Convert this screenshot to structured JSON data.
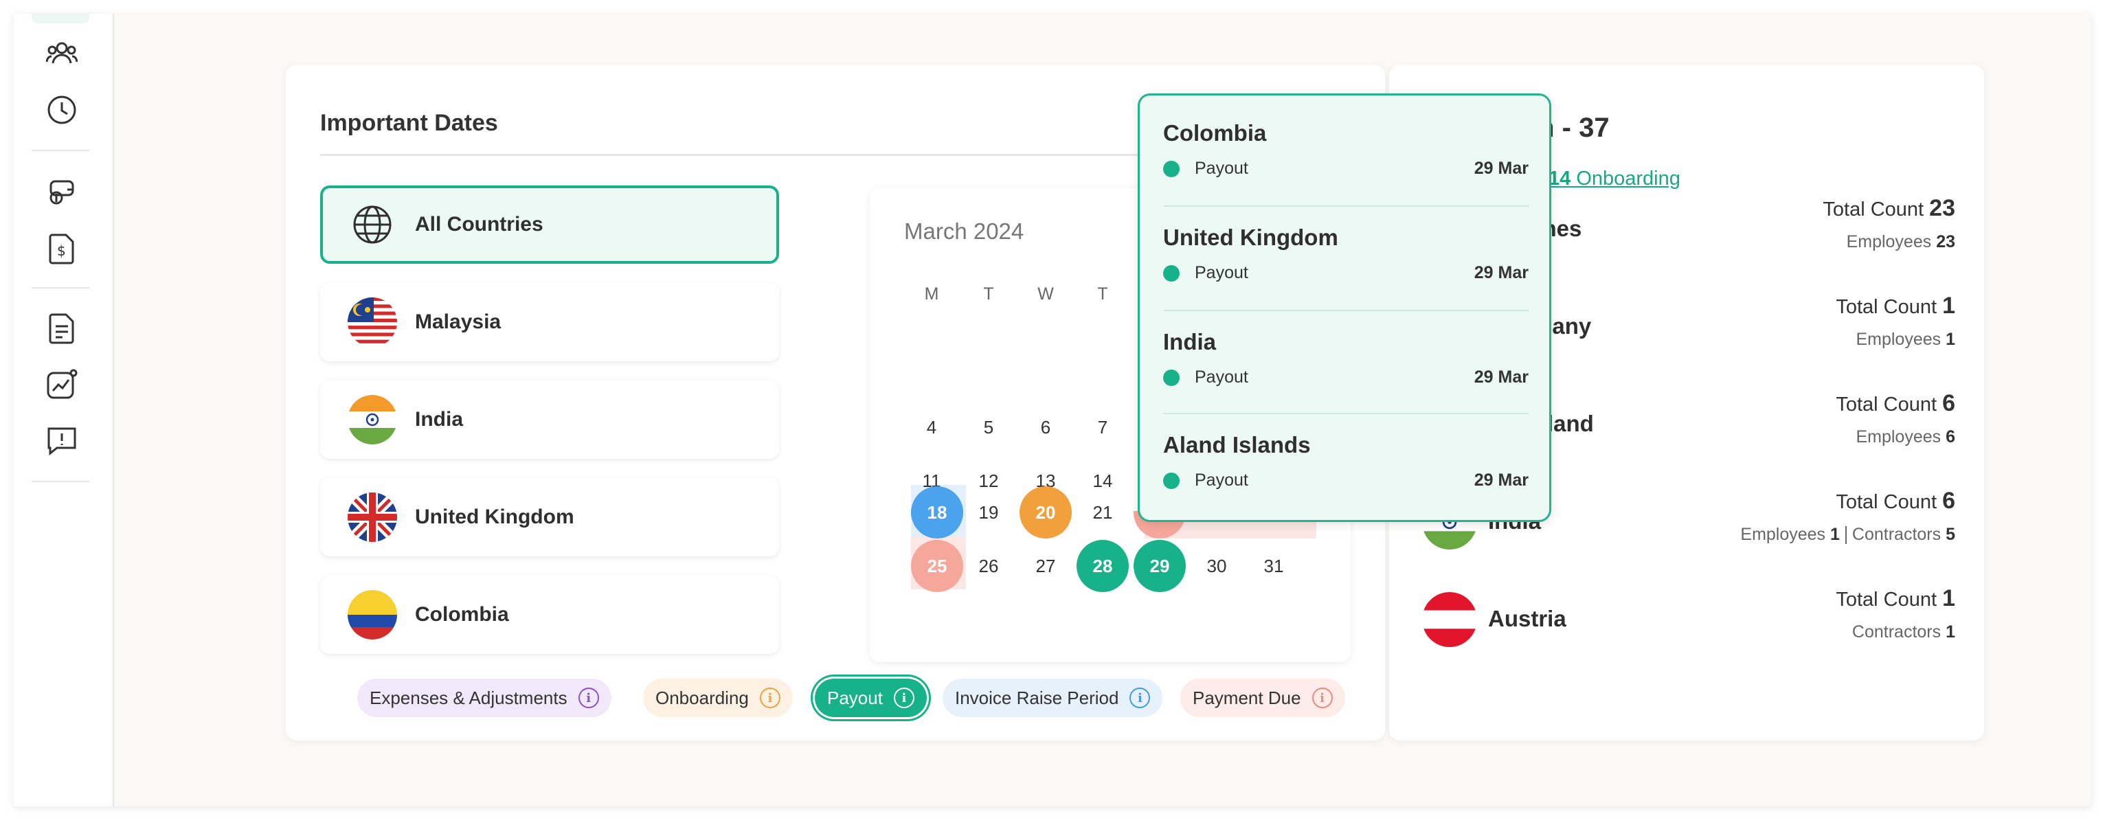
{
  "important_dates": {
    "title": "Important Dates",
    "countries": [
      {
        "name": "All Countries",
        "icon": "globe-icon",
        "active": true
      },
      {
        "name": "Malaysia",
        "icon": "malaysia-flag",
        "active": false
      },
      {
        "name": "India",
        "icon": "india-flag",
        "active": false
      },
      {
        "name": "United Kingdom",
        "icon": "uk-flag",
        "active": false
      },
      {
        "name": "Colombia",
        "icon": "colombia-flag",
        "active": false
      }
    ]
  },
  "calendar": {
    "month": "March 2024",
    "weekdays": [
      "M",
      "T",
      "W",
      "T"
    ],
    "days": {
      "d4": "4",
      "d5": "5",
      "d6": "6",
      "d7": "7",
      "d11": "11",
      "d12": "12",
      "d13": "13",
      "d14": "14",
      "d18": "18",
      "d19": "19",
      "d20": "20",
      "d21": "21",
      "d25": "25",
      "d26": "26",
      "d27": "27",
      "d28": "28",
      "d29": "29",
      "d30": "30",
      "d31": "31"
    }
  },
  "legend": [
    {
      "label": "Expenses & Adjustments",
      "color": "#8a4fd6",
      "bg": "#f1e9fb"
    },
    {
      "label": "Onboarding",
      "color": "#f0a23a",
      "bg": "#fdf1e3"
    },
    {
      "label": "Payout",
      "color": "#ffffff",
      "bg": "#17b28a"
    },
    {
      "label": "Invoice Raise Period",
      "color": "#3d9be9",
      "bg": "#e6f1fc"
    },
    {
      "label": "Payment Due",
      "color": "#f0877a",
      "bg": "#fdecea"
    }
  ],
  "popover": {
    "items": [
      {
        "country": "Colombia",
        "event": "Payout",
        "date": "29 Mar"
      },
      {
        "country": "United Kingdom",
        "event": "Payout",
        "date": "29 Mar"
      },
      {
        "country": "India",
        "event": "Payout",
        "date": "29 Mar"
      },
      {
        "country": "Aland Islands",
        "event": "Payout",
        "date": "29 Mar"
      }
    ]
  },
  "summary": {
    "title_fragment": "m - 37",
    "onboarding_count": "14",
    "onboarding_label": " Onboarding",
    "rows": [
      {
        "name_fragment": "opines",
        "total_label": "Total Count ",
        "total": "23",
        "sub": [
          {
            "label": "Employees ",
            "value": "23"
          }
        ]
      },
      {
        "name_fragment": "many",
        "total_label": "Total Count ",
        "total": "1",
        "sub": [
          {
            "label": "Employees ",
            "value": "1"
          }
        ]
      },
      {
        "name_fragment": "land",
        "total_label": "Total Count ",
        "total": "6",
        "sub": [
          {
            "label": "Employees ",
            "value": "6"
          }
        ]
      },
      {
        "name": "India",
        "total_label": "Total Count ",
        "total": "6",
        "sub": [
          {
            "label": "Employees ",
            "value": "1"
          },
          {
            "label": "Contractors ",
            "value": "5"
          }
        ]
      },
      {
        "name": "Austria",
        "total_label": "Total Count ",
        "total": "1",
        "sub": [
          {
            "label": "Contractors ",
            "value": "1"
          }
        ]
      }
    ]
  },
  "colors": {
    "accent": "#17b28a",
    "blue": "#4aa3ec",
    "orange": "#f2a03c",
    "salmon": "#f6a79b",
    "band_pink": "#fde7e4",
    "band_blue": "#e3f0fb"
  }
}
